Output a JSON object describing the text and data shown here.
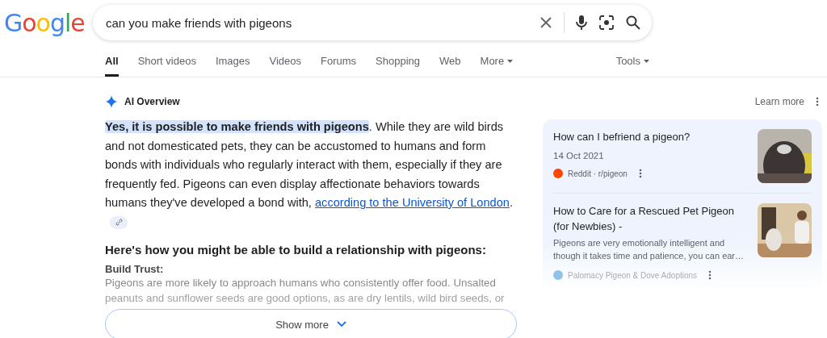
{
  "logo": "Google",
  "search": {
    "value": "can you make friends with pigeons"
  },
  "tabs": [
    {
      "label": "All",
      "selected": true
    },
    {
      "label": "Short videos",
      "selected": false
    },
    {
      "label": "Images",
      "selected": false
    },
    {
      "label": "Videos",
      "selected": false
    },
    {
      "label": "Forums",
      "selected": false
    },
    {
      "label": "Shopping",
      "selected": false
    },
    {
      "label": "Web",
      "selected": false
    },
    {
      "label": "More",
      "selected": false,
      "kind": "menu"
    }
  ],
  "tools": "Tools",
  "overview": {
    "title": "AI Overview",
    "learn_more": "Learn more",
    "paragraph": {
      "highlight": "Yes, it is possible to make friends with pigeons",
      "text": ". While they are wild birds and not domesticated pets, they can be accustomed to humans and form bonds with individuals who regularly interact with them, especially if they are frequently fed. Pigeons can even display affectionate behaviors towards humans they've developed a bond with, ",
      "link": "according to the University of London",
      "end": "."
    },
    "heading": "Here's how you might be able to build a relationship with pigeons:",
    "subheading": "Build Trust:",
    "faded": [
      "Pigeons are more likely to approach humans who consistently offer food. Unsalted",
      "peanuts and sunflower seeds are good options, as are dry lentils, wild bird seeds, or"
    ],
    "show_more": "Show more"
  },
  "sources": [
    {
      "title": "How can I befriend a pigeon?",
      "date": "14 Oct 2021",
      "site": "Reddit · r/pigeon",
      "color": "#ff4500",
      "kind": "picture"
    },
    {
      "title": "How to Care for a Rescued Pet Pigeon (for Newbies) -",
      "snippet": "Pigeons are very emotionally intelligent and though it takes time and patience, you can ear…",
      "site": "Palomacy Pigeon & Dove Adoptions",
      "color": "#8fc3e8",
      "kind": "picture"
    }
  ]
}
